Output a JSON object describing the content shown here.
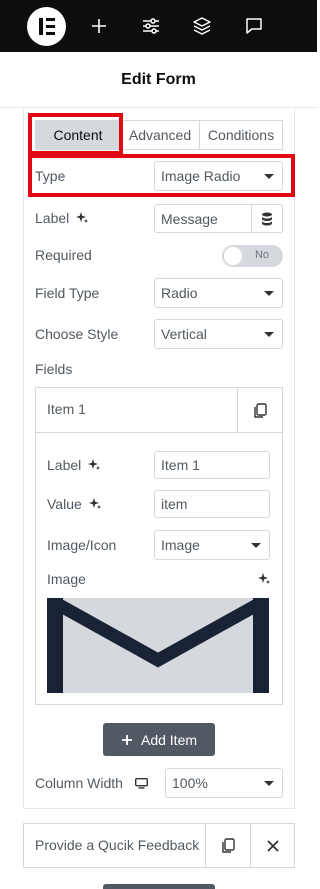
{
  "header": {
    "title": "Edit Form"
  },
  "tabs": [
    {
      "label": "Content",
      "active": true
    },
    {
      "label": "Advanced",
      "active": false
    },
    {
      "label": "Conditions",
      "active": false
    }
  ],
  "fields": {
    "type": {
      "label": "Type",
      "value": "Image Radio"
    },
    "label": {
      "label": "Label",
      "value": "Message"
    },
    "required": {
      "label": "Required",
      "toggle_text": "No",
      "checked": false
    },
    "field_type": {
      "label": "Field Type",
      "value": "Radio"
    },
    "choose_style": {
      "label": "Choose Style",
      "value": "Vertical"
    },
    "fields_label": "Fields",
    "column_width": {
      "label": "Column Width",
      "value": "100%"
    }
  },
  "repeater": {
    "item_title": "Item 1",
    "item": {
      "label": {
        "label": "Label",
        "value": "Item 1"
      },
      "value": {
        "label": "Value",
        "value": "item"
      },
      "image_icon": {
        "label": "Image/Icon",
        "value": "Image"
      },
      "image": {
        "label": "Image"
      }
    },
    "add_label": "Add Item"
  },
  "feedback": {
    "text": "Provide a Qucik Feedback"
  },
  "colors": {
    "topbar": "#0c0d0e",
    "highlight": "#e10a14",
    "button": "#515962",
    "border": "#d5d8dc"
  },
  "icons": [
    "elementor-logo-icon",
    "plus-icon",
    "sliders-icon",
    "layers-icon",
    "chat-icon",
    "sparkle-icon",
    "database-icon",
    "copy-icon",
    "close-icon",
    "desktop-icon",
    "envelope-icon"
  ]
}
